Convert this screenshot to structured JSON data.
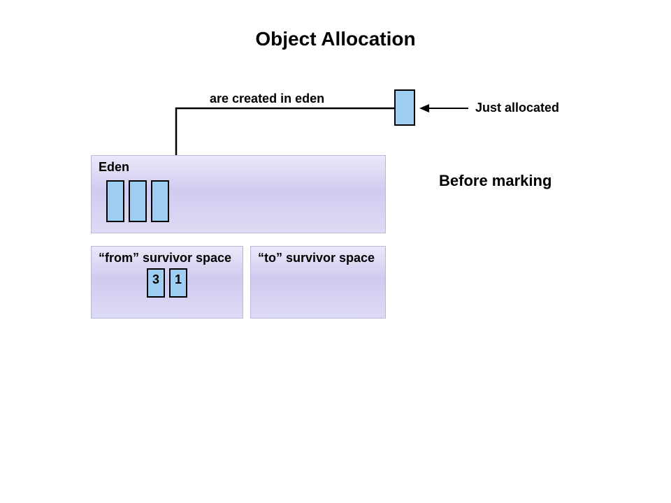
{
  "title": "Object Allocation",
  "labels": {
    "created_in_eden": "are created in eden",
    "just_allocated": "Just allocated",
    "before_marking": "Before marking"
  },
  "regions": {
    "eden": {
      "label": "Eden"
    },
    "from_survivor": {
      "label": "“from” survivor space"
    },
    "to_survivor": {
      "label": "“to” survivor space"
    }
  },
  "objects": {
    "allocated_new": {
      "value": ""
    },
    "eden_objs": [
      {
        "value": ""
      },
      {
        "value": ""
      },
      {
        "value": ""
      }
    ],
    "from_objs": [
      {
        "value": "3"
      },
      {
        "value": "1"
      }
    ]
  },
  "colors": {
    "object_fill": "#9ecff2",
    "region_gradient_top": "#eae8f8",
    "region_gradient_mid": "#cfcbf0",
    "region_gradient_bottom": "#dedbf5"
  }
}
